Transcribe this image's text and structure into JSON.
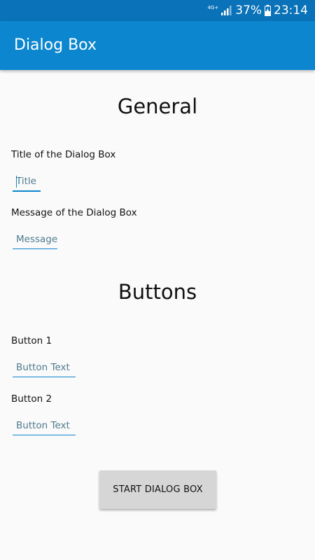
{
  "status_bar": {
    "network_type": "4G+",
    "battery_percent": "37%",
    "time": "23:14"
  },
  "app_bar": {
    "title": "Dialog Box"
  },
  "general": {
    "heading": "General",
    "title_label": "Title of the Dialog Box",
    "title_placeholder": "Title",
    "message_label": "Message of the Dialog Box",
    "message_placeholder": "Message"
  },
  "buttons": {
    "heading": "Buttons",
    "button1_label": "Button 1",
    "button1_placeholder": "Button Text",
    "button2_label": "Button 2",
    "button2_placeholder": "Button Text"
  },
  "actions": {
    "start_label": "START DIALOG BOX"
  },
  "colors": {
    "status_bar": "#0a72b8",
    "app_bar": "#0b86cf",
    "accent": "#0b86cf",
    "background": "#fafafa",
    "button": "#d6d6d6"
  }
}
